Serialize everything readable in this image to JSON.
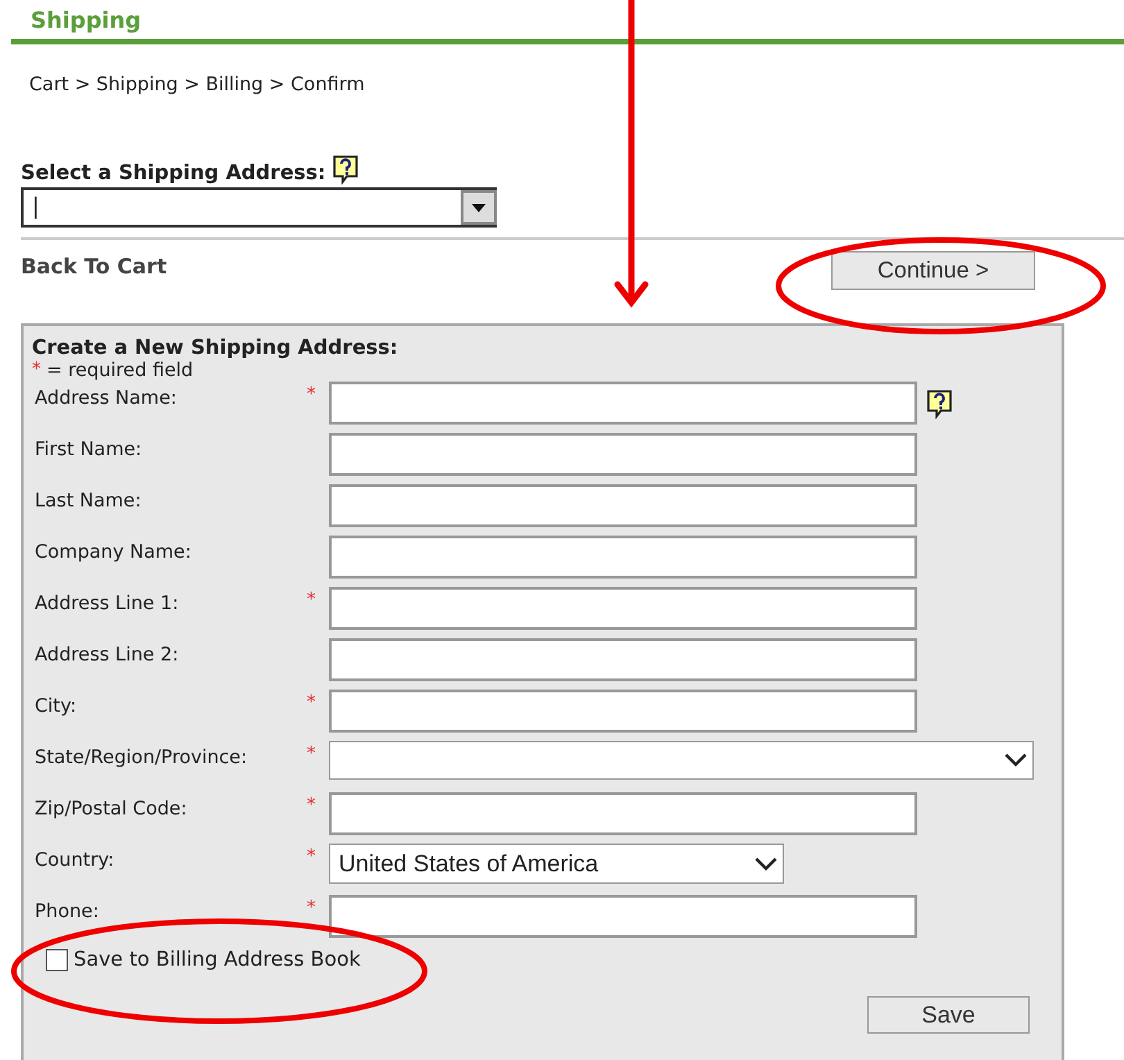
{
  "header": {
    "title": "Shipping"
  },
  "breadcrumb": "Cart > Shipping > Billing > Confirm",
  "address_select": {
    "label": "Select a Shipping Address:",
    "value": "|"
  },
  "back_link": "Back To Cart",
  "continue_button": "Continue >",
  "form": {
    "title": "Create a New Shipping Address:",
    "required_mark": "*",
    "required_note": "= required field",
    "fields": [
      {
        "label": "Address Name:",
        "kind": "text",
        "required": true,
        "help": true
      },
      {
        "label": "First Name:",
        "kind": "text",
        "required": false,
        "help": false
      },
      {
        "label": "Last Name:",
        "kind": "text",
        "required": false,
        "help": false
      },
      {
        "label": "Company Name:",
        "kind": "text",
        "required": false,
        "help": false
      },
      {
        "label": "Address Line 1:",
        "kind": "text",
        "required": true,
        "help": false
      },
      {
        "label": "Address Line 2:",
        "kind": "text",
        "required": false,
        "help": false
      },
      {
        "label": "City:",
        "kind": "text",
        "required": true,
        "help": false
      },
      {
        "label": "State/Region/Province:",
        "kind": "wideselect",
        "required": true,
        "help": false
      },
      {
        "label": "Zip/Postal Code:",
        "kind": "text",
        "required": true,
        "help": false
      },
      {
        "label": "Country:",
        "kind": "select",
        "required": true,
        "help": false,
        "value": "United States of America"
      },
      {
        "label": "Phone:",
        "kind": "text",
        "required": true,
        "help": false
      }
    ],
    "save_to_billing": {
      "label": "Save to Billing Address Book",
      "checked": false
    },
    "save_button": "Save"
  }
}
